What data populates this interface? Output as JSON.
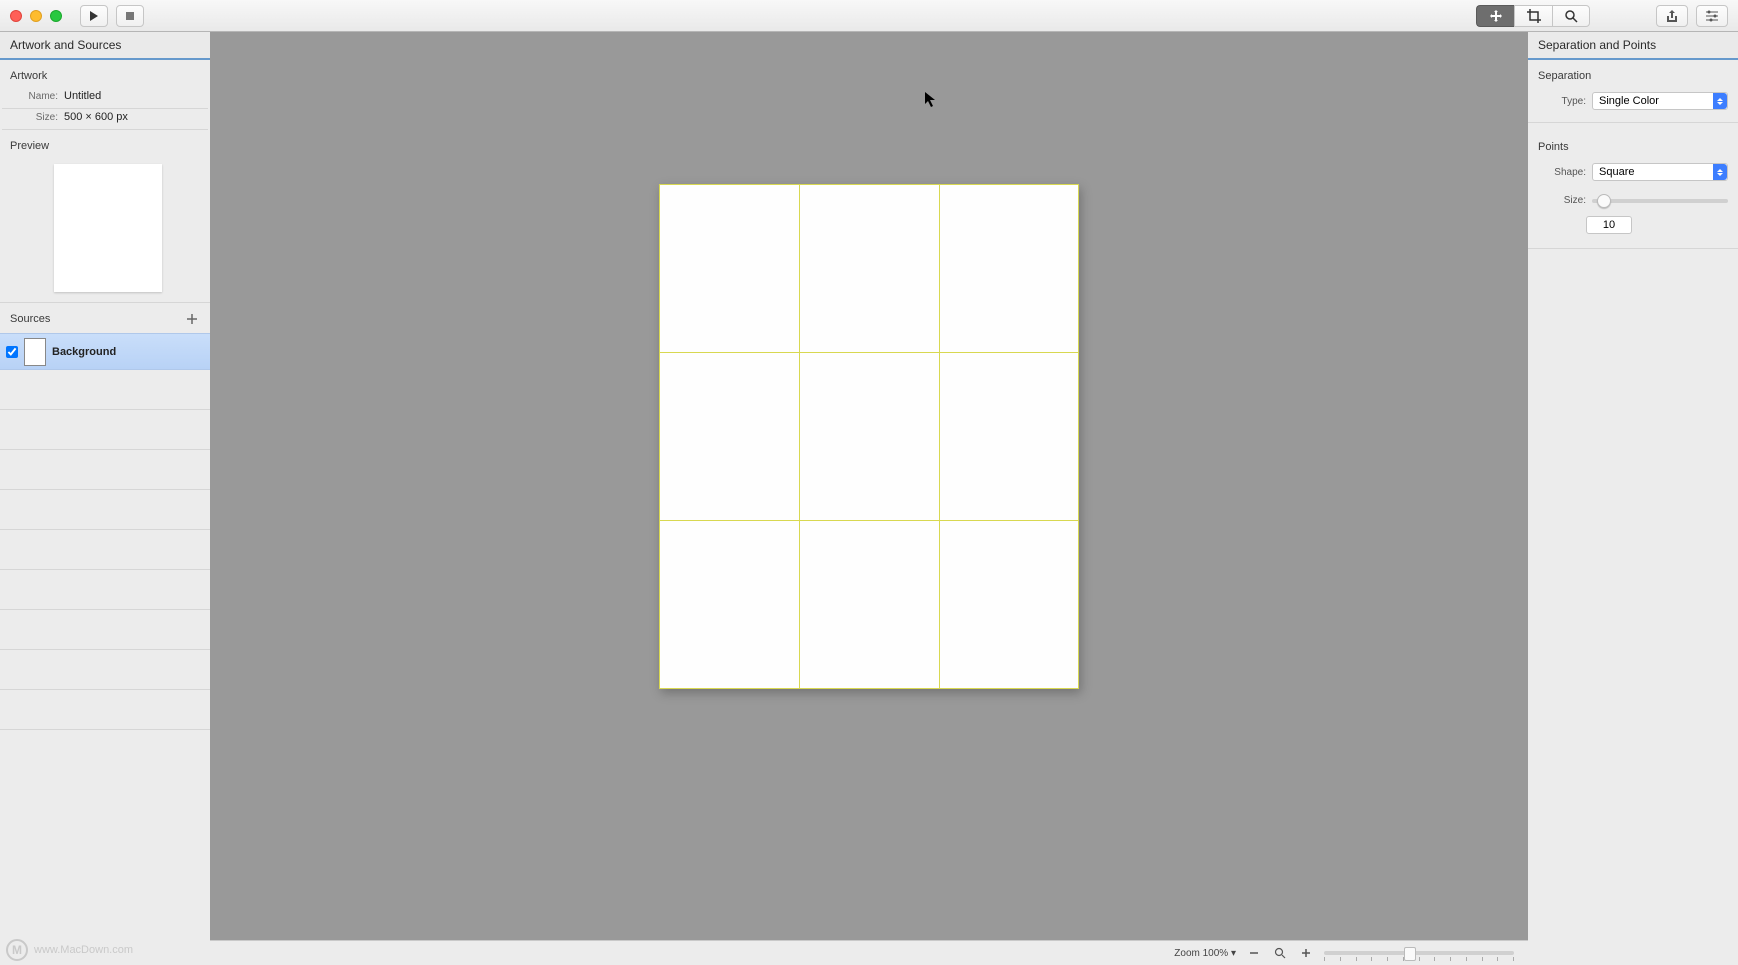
{
  "toolbar": {},
  "left_panel": {
    "title": "Artwork and Sources",
    "artwork_heading": "Artwork",
    "name_label": "Name:",
    "name_value": "Untitled",
    "size_label": "Size:",
    "size_value": "500 × 600 px",
    "preview_heading": "Preview",
    "sources_heading": "Sources",
    "sources": [
      {
        "name": "Background",
        "checked": true
      }
    ]
  },
  "right_panel": {
    "title": "Separation and Points",
    "separation_heading": "Separation",
    "type_label": "Type:",
    "type_value": "Single Color",
    "points_heading": "Points",
    "shape_label": "Shape:",
    "shape_value": "Square",
    "size_label": "Size:",
    "size_value": "10"
  },
  "status": {
    "zoom_label": "Zoom 100% ▾"
  },
  "watermark": {
    "text": "www.MacDown.com",
    "badge": "M"
  }
}
